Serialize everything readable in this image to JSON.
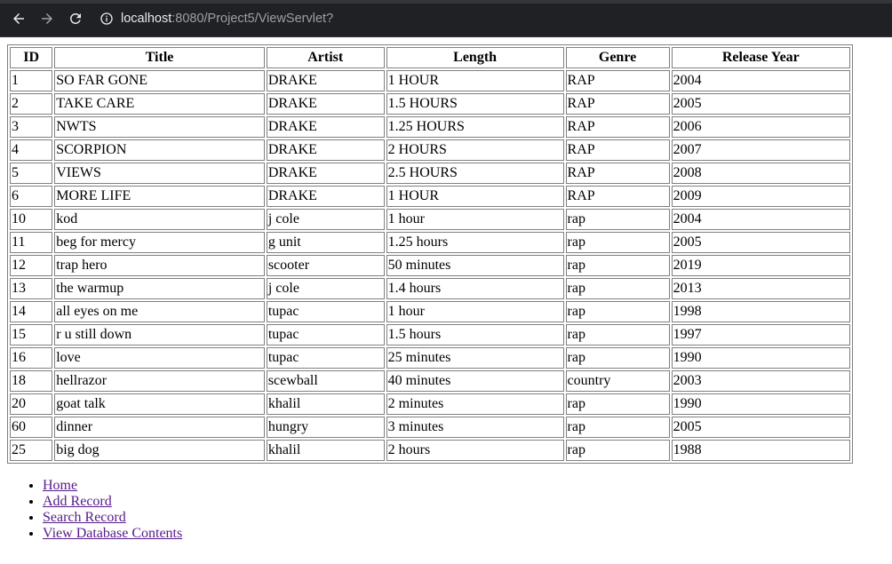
{
  "browser": {
    "url_host": "localhost",
    "url_rest": ":8080/Project5/ViewServlet?"
  },
  "table": {
    "headers": [
      "ID",
      "Title",
      "Artist",
      "Length",
      "Genre",
      "Release Year"
    ],
    "rows": [
      [
        "1",
        "SO FAR GONE",
        "DRAKE",
        "1 HOUR",
        "RAP",
        "2004"
      ],
      [
        "2",
        "TAKE CARE",
        "DRAKE",
        "1.5 HOURS",
        "RAP",
        "2005"
      ],
      [
        "3",
        "NWTS",
        "DRAKE",
        "1.25 HOURS",
        "RAP",
        "2006"
      ],
      [
        "4",
        "SCORPION",
        "DRAKE",
        "2 HOURS",
        "RAP",
        "2007"
      ],
      [
        "5",
        "VIEWS",
        "DRAKE",
        "2.5 HOURS",
        "RAP",
        "2008"
      ],
      [
        "6",
        "MORE LIFE",
        "DRAKE",
        "1 HOUR",
        "RAP",
        "2009"
      ],
      [
        "10",
        "kod",
        "j cole",
        "1 hour",
        "rap",
        "2004"
      ],
      [
        "11",
        "beg for mercy",
        "g unit",
        "1.25 hours",
        "rap",
        "2005"
      ],
      [
        "12",
        "trap hero",
        "scooter",
        "50 minutes",
        "rap",
        "2019"
      ],
      [
        "13",
        "the warmup",
        "j cole",
        "1.4 hours",
        "rap",
        "2013"
      ],
      [
        "14",
        "all eyes on me",
        "tupac",
        "1 hour",
        "rap",
        "1998"
      ],
      [
        "15",
        "r u still down",
        "tupac",
        "1.5 hours",
        "rap",
        "1997"
      ],
      [
        "16",
        "love",
        "tupac",
        "25 minutes",
        "rap",
        "1990"
      ],
      [
        "18",
        "hellrazor",
        "scewball",
        "40 minutes",
        "country",
        "2003"
      ],
      [
        "20",
        "goat talk",
        "khalil",
        "2 minutes",
        "rap",
        "1990"
      ],
      [
        "60",
        "dinner",
        "hungry",
        "3 minutes",
        "rap",
        "2005"
      ],
      [
        "25",
        "big dog",
        "khalil",
        "2 hours",
        "rap",
        "1988"
      ]
    ]
  },
  "links": [
    {
      "label": "Home",
      "name": "home-link"
    },
    {
      "label": "Add Record",
      "name": "add-record-link"
    },
    {
      "label": "Search Record",
      "name": "search-record-link"
    },
    {
      "label": "View Database Contents",
      "name": "view-database-link"
    }
  ],
  "colors": {
    "chrome_bg": "#202124",
    "link_visited": "#551a8b",
    "border": "#808080"
  },
  "icons": [
    "back-arrow-icon",
    "forward-arrow-icon",
    "reload-icon",
    "info-icon"
  ]
}
